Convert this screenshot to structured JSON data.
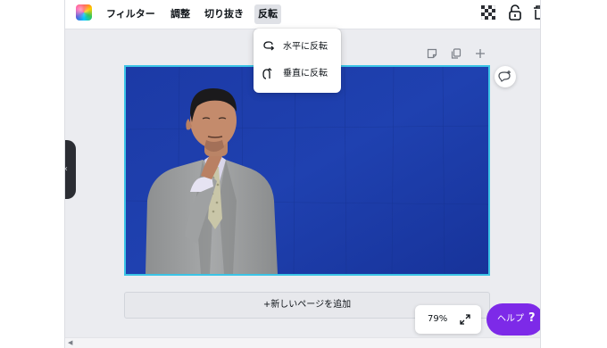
{
  "toolbar": {
    "filter_label": "フィルター",
    "adjust_label": "調整",
    "crop_label": "切り抜き",
    "flip_label": "反転"
  },
  "flip_menu": {
    "horizontal_label": "水平に反転",
    "vertical_label": "垂直に反転"
  },
  "add_page_label": "+新しいページを追加",
  "zoom": {
    "label": "79%"
  },
  "help": {
    "label": "ヘルプ",
    "icon_text": "?"
  },
  "colors": {
    "accent_purple": "#7d2ae8",
    "selection_cyan": "#3bc4e6",
    "photo_background_blue": "#1f3fa8"
  },
  "icons": [
    "color-swatch-icon",
    "transparency-icon",
    "lock-icon",
    "trash-icon",
    "flip-horizontal-icon",
    "flip-vertical-icon",
    "note-icon",
    "duplicate-icon",
    "add-page-icon",
    "comment-add-icon",
    "expand-icon",
    "chevron-left-icon"
  ]
}
